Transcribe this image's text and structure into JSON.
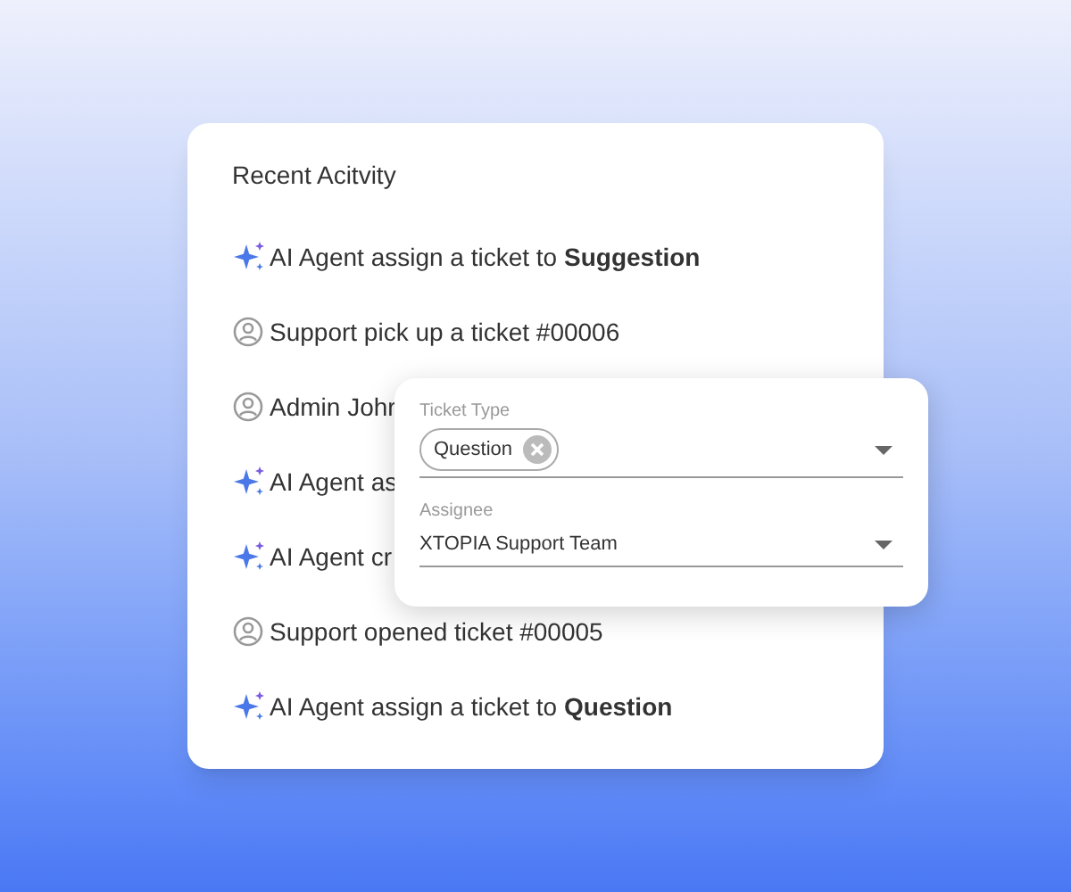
{
  "card": {
    "title": "Recent Acitvity",
    "items": [
      {
        "kind": "ai",
        "text": "AI Agent assign a ticket to **Suggestion**"
      },
      {
        "kind": "user",
        "text": "Support pick up a ticket #00006"
      },
      {
        "kind": "user",
        "text": "Admin Johr"
      },
      {
        "kind": "ai",
        "text": "AI Agent as"
      },
      {
        "kind": "ai",
        "text": "AI Agent cr"
      },
      {
        "kind": "user",
        "text": "Support opened ticket #00005"
      },
      {
        "kind": "ai",
        "text": "AI Agent assign a ticket to **Question**"
      }
    ]
  },
  "popup": {
    "fields": [
      {
        "label": "Ticket Type",
        "kind": "chips",
        "chips": [
          "Question"
        ]
      },
      {
        "label": "Assignee",
        "kind": "text",
        "value": "XTOPIA Support Team"
      }
    ]
  }
}
